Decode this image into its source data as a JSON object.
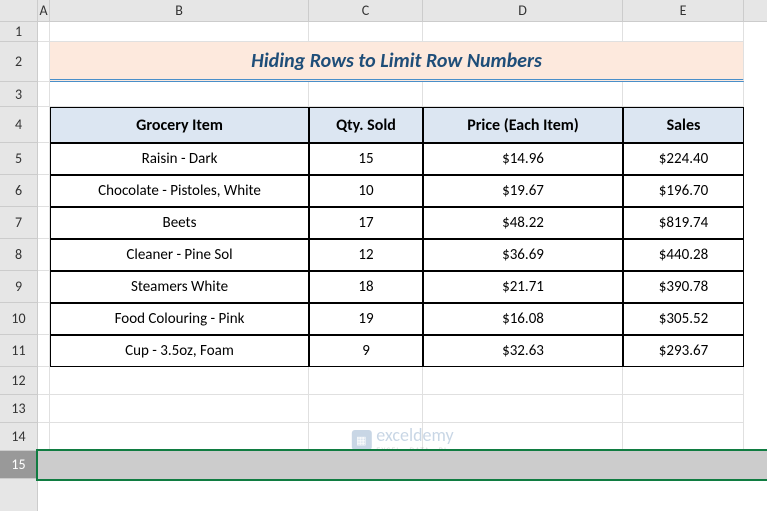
{
  "columns": [
    "A",
    "B",
    "C",
    "D",
    "E"
  ],
  "rows": [
    "1",
    "2",
    "3",
    "4",
    "5",
    "6",
    "7",
    "8",
    "9",
    "10",
    "11",
    "12",
    "13",
    "14",
    "15"
  ],
  "title": "Hiding Rows to Limit Row Numbers",
  "table": {
    "headers": {
      "item": "Grocery Item",
      "qty": "Qty. Sold",
      "price": "Price (Each Item)",
      "sales": "Sales"
    },
    "data": [
      {
        "item": "Raisin - Dark",
        "qty": "15",
        "price": "$14.96",
        "sales": "$224.40"
      },
      {
        "item": "Chocolate - Pistoles, White",
        "qty": "10",
        "price": "$19.67",
        "sales": "$196.70"
      },
      {
        "item": "Beets",
        "qty": "17",
        "price": "$48.22",
        "sales": "$819.74"
      },
      {
        "item": "Cleaner - Pine Sol",
        "qty": "12",
        "price": "$36.69",
        "sales": "$440.28"
      },
      {
        "item": "Steamers White",
        "qty": "18",
        "price": "$21.71",
        "sales": "$390.78"
      },
      {
        "item": "Food Colouring - Pink",
        "qty": "19",
        "price": "$16.08",
        "sales": "$305.52"
      },
      {
        "item": "Cup - 3.5oz, Foam",
        "qty": "9",
        "price": "$32.63",
        "sales": "$293.67"
      }
    ]
  },
  "watermark": {
    "brand": "exceldemy",
    "tagline": "EXCEL · DATA · BI"
  }
}
